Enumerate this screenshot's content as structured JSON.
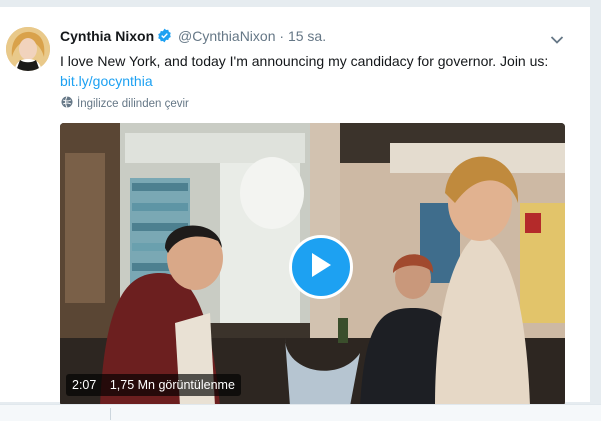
{
  "tweet": {
    "name": "Cynthia Nixon",
    "handle": "@CynthiaNixon",
    "separator": "·",
    "time": "15 sa.",
    "text": "I love New York, and today I'm announcing my candidacy for governor. Join us:",
    "link": "bit.ly/gocynthia",
    "translate_label": "İngilizce dilinden çevir"
  },
  "video": {
    "duration": "2:07",
    "views": "1,75 Mn görüntülenme"
  },
  "icons": {
    "verified": "verified-badge-icon",
    "caret": "chevron-down-icon",
    "globe": "globe-icon",
    "play": "play-icon"
  },
  "colors": {
    "accent": "#1da1f2",
    "text": "#14171a",
    "muted": "#657786"
  }
}
